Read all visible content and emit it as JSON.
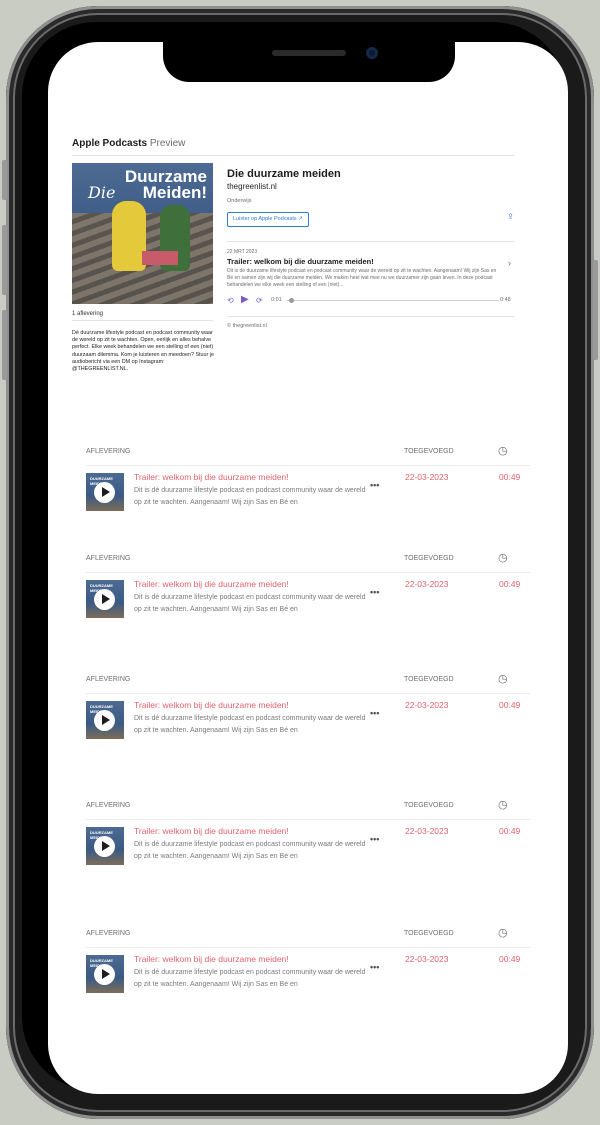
{
  "widget": {
    "brand": "Apple Podcasts",
    "brand_suffix": "Preview",
    "cover_text_1": "Duurzame",
    "cover_text_2": "Meiden!",
    "cover_text_3": "Die",
    "episode_count": "1 aflevering",
    "description": "Dé duurzame lifestyle podcast en podcast community waar de wereld op zit te wachten. Open, eerlijk en alles behalve perfect. Elke week behandelen we een stelling of een (niet) duurzaam dilemma. Kom je luisteren en meedoen? Stuur je audiobericht via een DM op Instagram: @THEGREENLIST.NL.",
    "title": "Die duurzame meiden",
    "author": "thegreenlist.nl",
    "category": "Onderwijs",
    "listen_label": "Luister op Apple Podcasts ↗",
    "share_icon": "share-icon",
    "episode": {
      "date": "22 MRT 2023",
      "title": "Trailer: welkom bij die duurzame meiden!",
      "description": "Dit is dé duurzame lifestyle podcast en podcast community waar de wereld op zit te wachten. Aangenaam! Wij zijn Sas en Bé en samen zijn wij die duurzame meiden. We maken heel wat mee nu we duurzamer zijn gaan leven. In deze podcast behandelen we elke week een stelling of een (niet)...",
      "time_elapsed": "0:01",
      "time_total": "0:48"
    },
    "copyright": "© thegreenlist.nl"
  },
  "tables": [
    {
      "header_episode": "AFLEVERING",
      "header_added": "TOEGEVOEGD",
      "row": {
        "thumb_text": "DUURZAME MEIDEN",
        "title": "Trailer: welkom bij die duurzame meiden!",
        "description": "Dit is dé duurzame lifestyle podcast en podcast community waar de wereld op zit te wachten. Aangenaam! Wij zijn Sas en Bé en",
        "more": "•••",
        "date": "22-03-2023",
        "duration": "00:49"
      }
    },
    {
      "header_episode": "AFLEVERING",
      "header_added": "TOEGEVOEGD",
      "row": {
        "thumb_text": "DUURZAME MEIDEN",
        "title": "Trailer: welkom bij die duurzame meiden!",
        "description": "Dit is dé duurzame lifestyle podcast en podcast community waar de wereld op zit te wachten. Aangenaam! Wij zijn Sas en Bé en",
        "more": "•••",
        "date": "22-03-2023",
        "duration": "00:49"
      }
    },
    {
      "header_episode": "AFLEVERING",
      "header_added": "TOEGEVOEGD",
      "row": {
        "thumb_text": "DUURZAME MEIDEN",
        "title": "Trailer: welkom bij die duurzame meiden!",
        "description": "Dit is dé duurzame lifestyle podcast en podcast community waar de wereld op zit te wachten. Aangenaam! Wij zijn Sas en Bé en",
        "more": "•••",
        "date": "22-03-2023",
        "duration": "00:49"
      }
    },
    {
      "header_episode": "AFLEVERING",
      "header_added": "TOEGEVOEGD",
      "row": {
        "thumb_text": "DUURZAME MEIDEN",
        "title": "Trailer: welkom bij die duurzame meiden!",
        "description": "Dit is dé duurzame lifestyle podcast en podcast community waar de wereld op zit te wachten. Aangenaam! Wij zijn Sas en Bé en",
        "more": "•••",
        "date": "22-03-2023",
        "duration": "00:49"
      }
    },
    {
      "header_episode": "AFLEVERING",
      "header_added": "TOEGEVOEGD",
      "row": {
        "thumb_text": "DUURZAME MEIDEN",
        "title": "Trailer: welkom bij die duurzame meiden!",
        "description": "Dit is dé duurzame lifestyle podcast en podcast community waar de wereld op zit te wachten. Aangenaam! Wij zijn Sas en Bé en",
        "more": "•••",
        "date": "22-03-2023",
        "duration": "00:49"
      }
    }
  ],
  "colors": {
    "accent_link": "#2f7bd8",
    "accent_player": "#7a5cc2",
    "accent_episode": "#e0636f"
  }
}
